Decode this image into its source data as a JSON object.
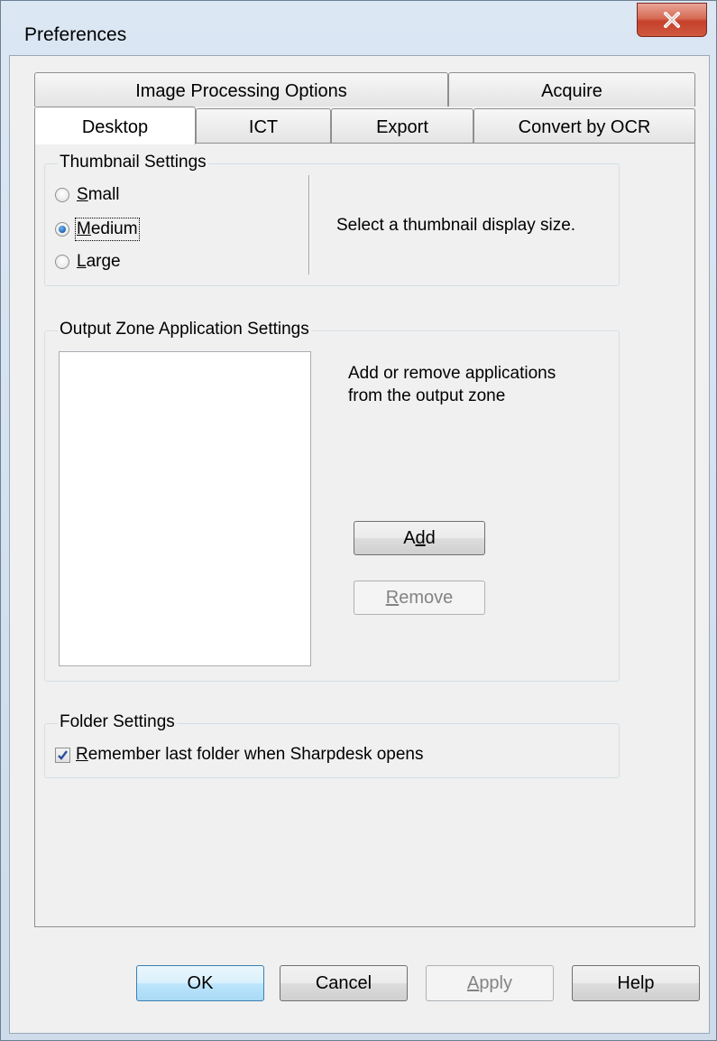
{
  "window": {
    "title": "Preferences",
    "close_icon": "close-icon"
  },
  "tabs": {
    "row1": [
      "Image Processing Options",
      "Acquire"
    ],
    "row2": [
      "Desktop",
      "ICT",
      "Export",
      "Convert by OCR"
    ],
    "active": "Desktop"
  },
  "thumbnail": {
    "legend": "Thumbnail Settings",
    "options": [
      {
        "prefix": "",
        "accel": "S",
        "rest": "mall",
        "checked": false
      },
      {
        "prefix": "",
        "accel": "M",
        "rest": "edium",
        "checked": true
      },
      {
        "prefix": "",
        "accel": "L",
        "rest": "arge",
        "checked": false
      }
    ],
    "description": "Select a thumbnail display size."
  },
  "output_zone": {
    "legend": "Output Zone Application Settings",
    "description_line1": "Add or remove applications",
    "description_line2": "from the output zone",
    "add_pre": "A",
    "add_accel": "d",
    "add_post": "d",
    "remove_accel": "R",
    "remove_post": "emove"
  },
  "folder": {
    "legend": "Folder Settings",
    "checkbox_accel": "R",
    "checkbox_rest": "emember last folder when Sharpdesk opens",
    "checked": true
  },
  "buttons": {
    "ok": "OK",
    "cancel": "Cancel",
    "apply_accel": "A",
    "apply_rest": "pply",
    "help": "Help"
  }
}
